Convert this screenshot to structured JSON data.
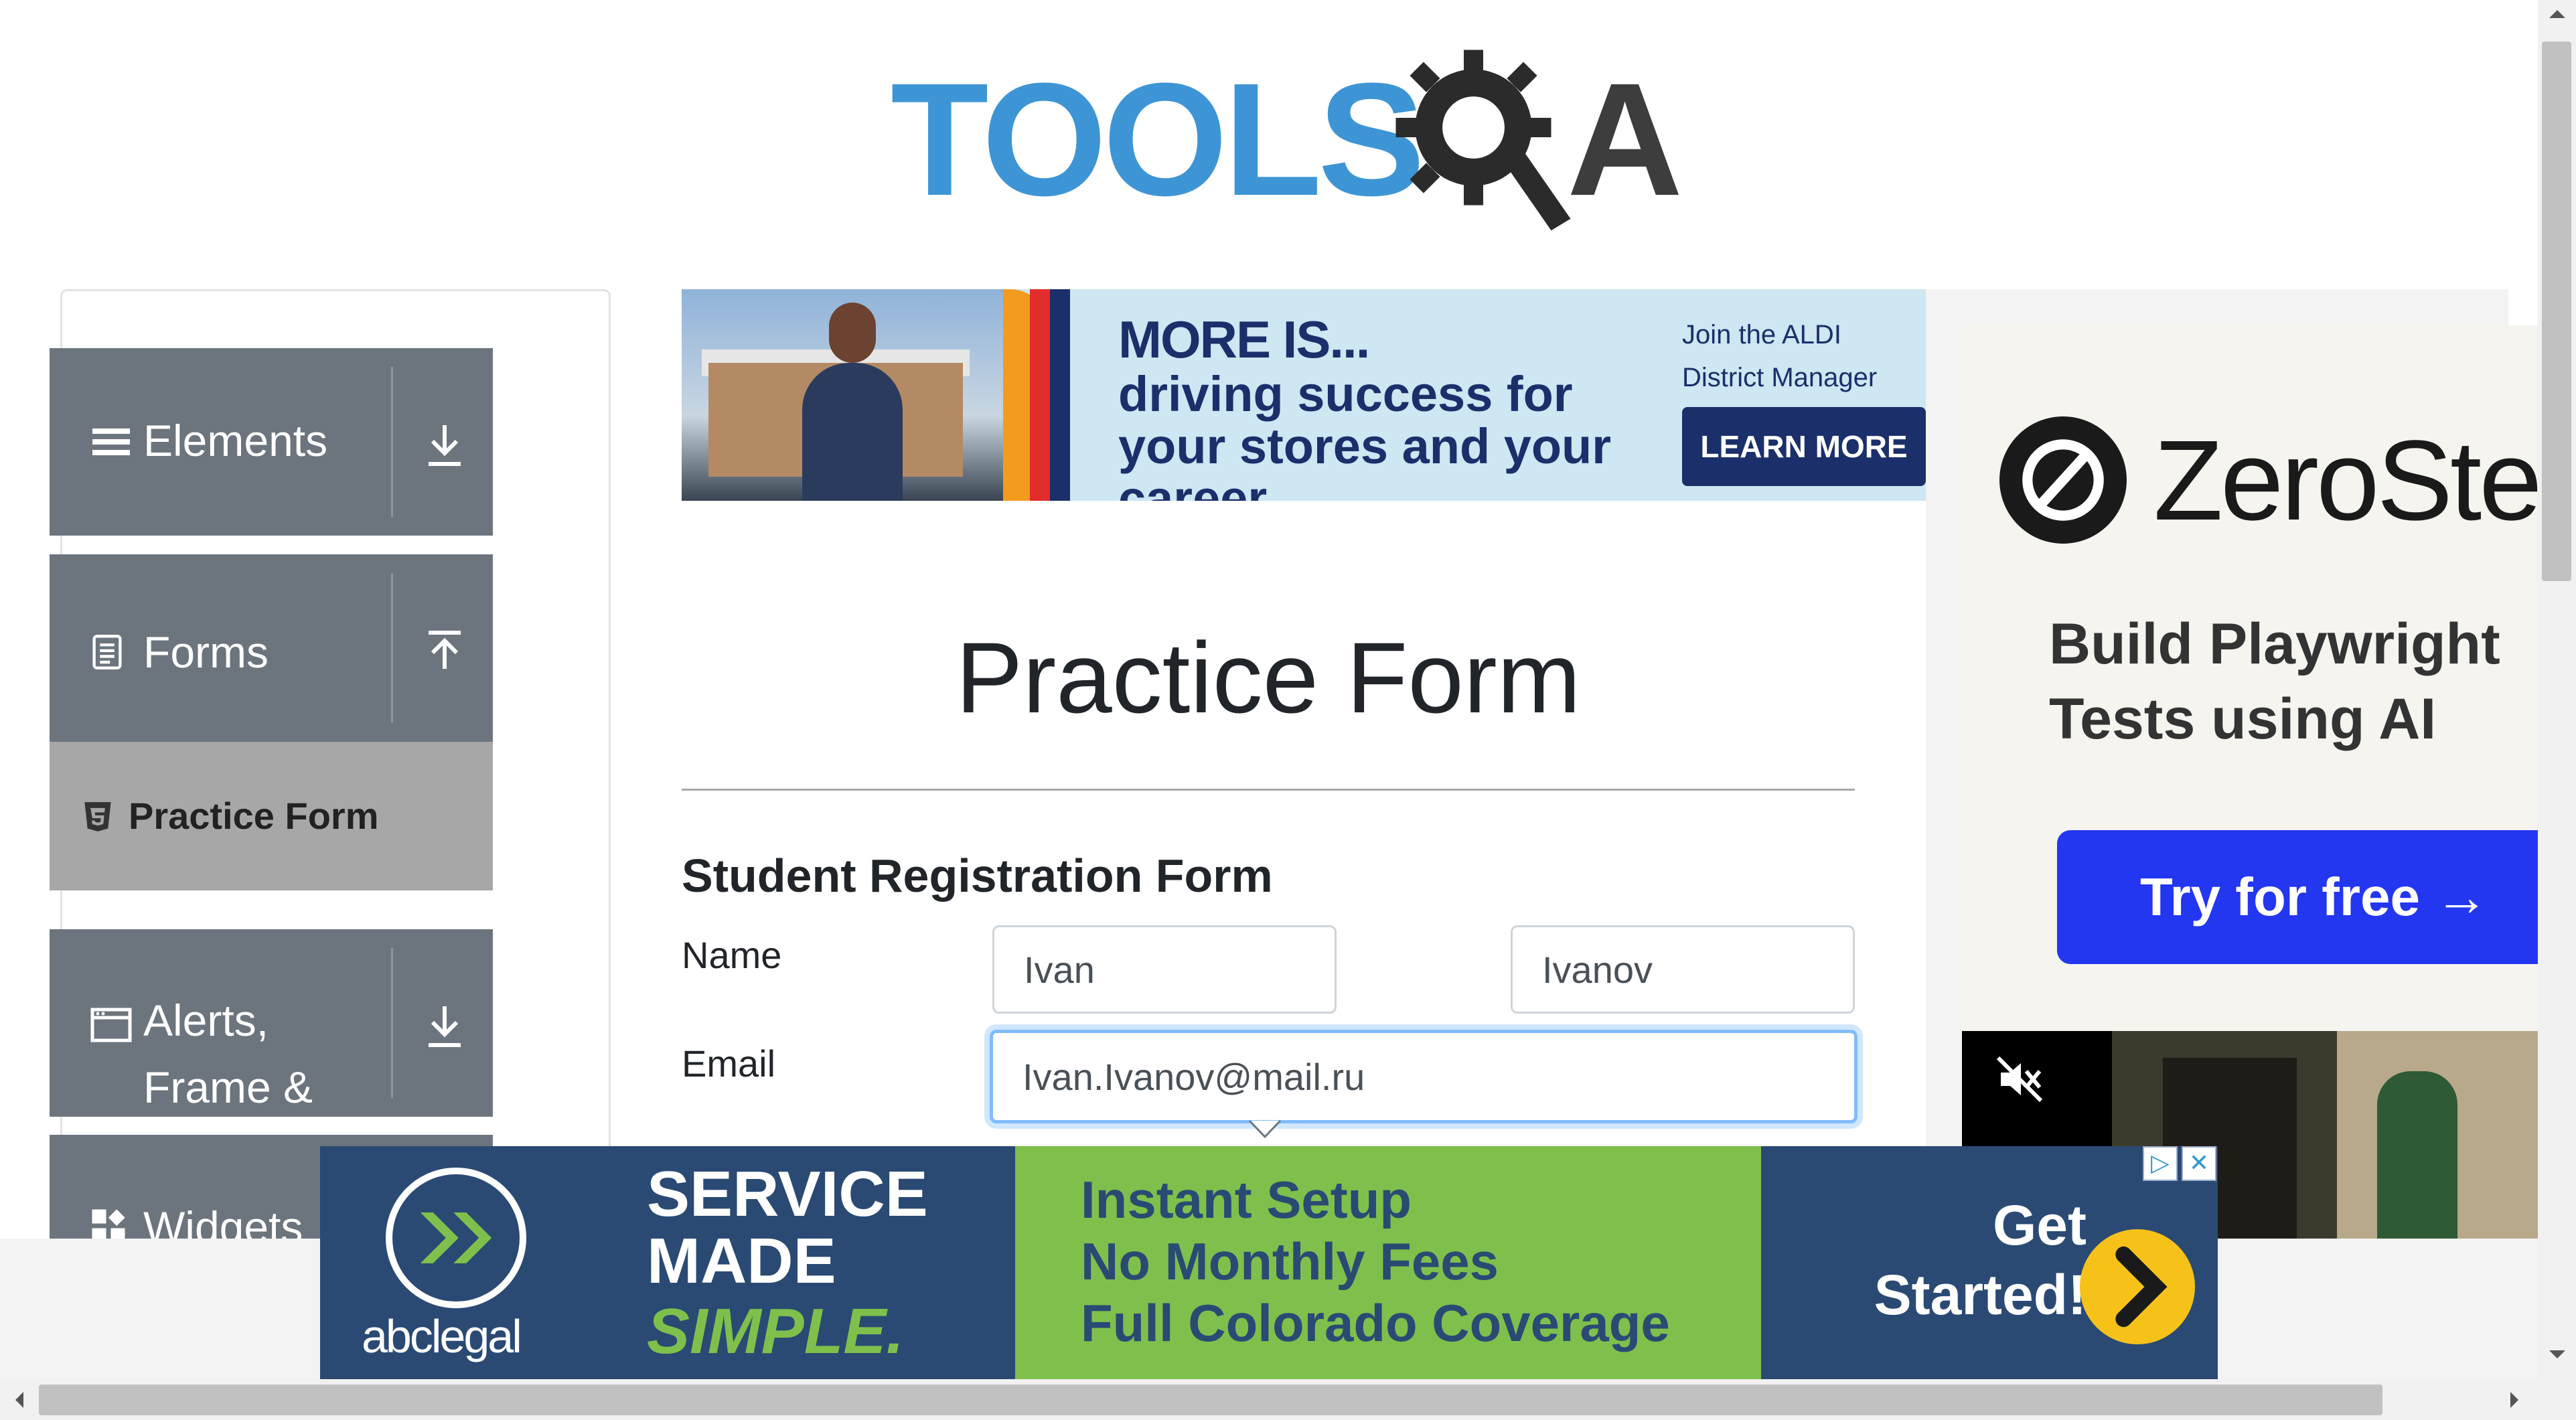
{
  "logo": {
    "word": "TOOLS",
    "q_letter": "Q",
    "a_letter": "A"
  },
  "sidebar": {
    "groups": [
      {
        "label": "Elements",
        "icon": "hamburger-icon",
        "arrow": "download-arrow-icon"
      },
      {
        "label": "Forms",
        "icon": "document-icon",
        "arrow": "upload-arrow-icon"
      },
      {
        "label": "Alerts, Frame & Windows",
        "icon": "window-icon",
        "arrow": "download-arrow-icon"
      },
      {
        "label": "Widgets",
        "icon": "widgets-icon"
      }
    ],
    "active_item": {
      "label": "Practice Form",
      "icon": "html5-icon"
    }
  },
  "ad_top": {
    "headline": "MORE IS...",
    "body": "driving success for your stores and your career.",
    "side_text": "Join the ALDI District Manager team.",
    "cta": "LEARN MORE"
  },
  "main": {
    "title": "Practice Form",
    "form_heading": "Student Registration Form",
    "name_label": "Name",
    "email_label": "Email",
    "first_name_value": "Ivan",
    "last_name_value": "Ivanov",
    "email_value": "Ivan.Ivanov@mail.ru"
  },
  "ad_right": {
    "brand": "ZeroSte",
    "subtitle": "Build Playwright Tests using AI",
    "cta": "Try for free →"
  },
  "ad_bottom": {
    "brand": "abclegal",
    "left_line1": "SERVICE",
    "left_line2": "MADE",
    "left_line3": "SIMPLE.",
    "mid_line1": "Instant Setup",
    "mid_line2": "No Monthly Fees",
    "mid_line3": "Full Colorado Coverage",
    "cta_line1": "Get",
    "cta_line2": "Started!"
  },
  "colors": {
    "logo_blue": "#3e95d5",
    "logo_dark": "#3d3d3d",
    "sidebar_group": "#6c757d",
    "sidebar_active": "#a7a7a7",
    "focus_border": "#80bdff",
    "ad_right_button": "#2336f0"
  }
}
